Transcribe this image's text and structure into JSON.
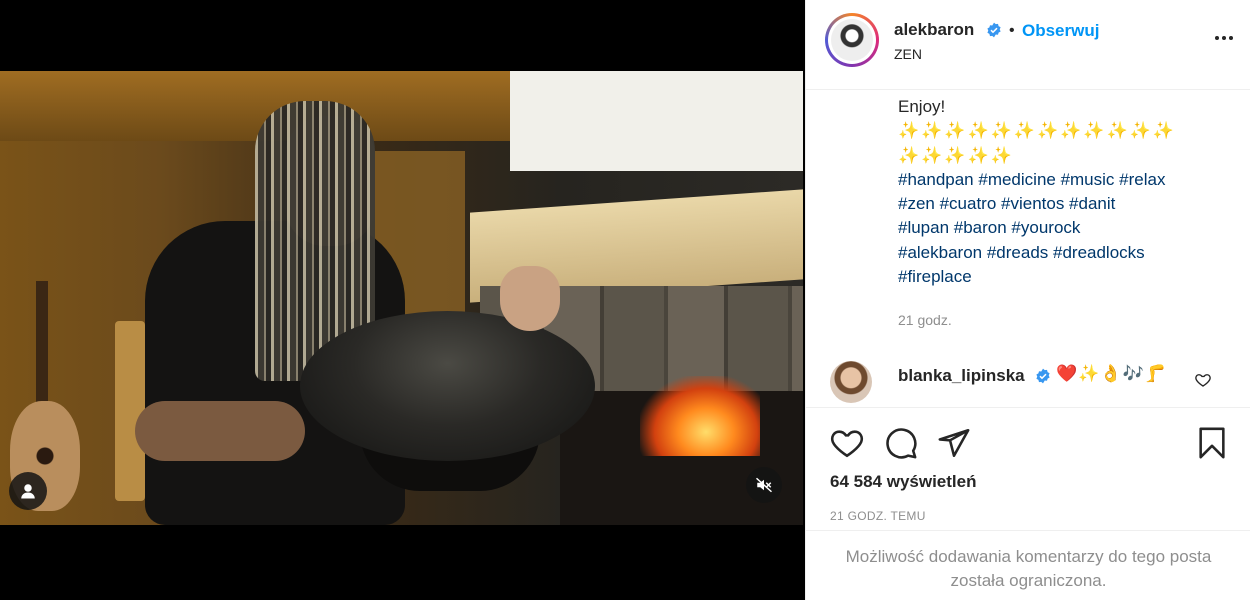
{
  "post": {
    "username": "alekbaron",
    "follow_label": "Obserwuj",
    "location": "ZEN",
    "dot": "•"
  },
  "caption": {
    "cut_line": "...",
    "enjoy": "Enjoy!",
    "emoji_line_1": "✨✨✨✨✨✨✨✨✨✨✨✨",
    "emoji_line_2": "✨✨✨✨✨",
    "hashtag_lines": [
      "#handpan #medicine #music #relax",
      "#zen #cuatro #vientos #danit",
      "#lupan #baron #yourock",
      "#alekbaron #dreads #dreadlocks",
      "#fireplace"
    ],
    "time": "21 godz."
  },
  "comment": {
    "username": "blanka_lipinska",
    "text": "❤️✨👌🎶🦵"
  },
  "stats": {
    "views": "64 584 wyświetleń",
    "posted": "21 GODZ. TEMU"
  },
  "comments_disabled": "Możliwość dodawania komentarzy do tego posta została ograniczona.",
  "icons": {
    "user_tag": "user-tag-icon",
    "mute": "muted-speaker-icon",
    "verified": "verified-badge-icon",
    "more": "more-options-icon",
    "like": "heart-icon",
    "comment": "comment-bubble-icon",
    "share": "paper-plane-icon",
    "save": "bookmark-icon"
  },
  "colors": {
    "link_blue": "#0095f6",
    "hashtag": "#00376b",
    "verified": "#3897f0",
    "muted_text": "#8e8e8e"
  }
}
